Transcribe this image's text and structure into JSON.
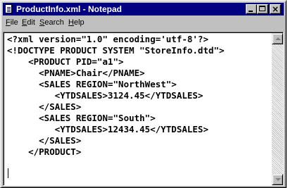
{
  "window": {
    "title": "ProductInfo.xml - Notepad",
    "icon": "notepad-icon"
  },
  "controls": {
    "minimize": "minimize-icon",
    "maximize": "maximize-icon",
    "close": "close-icon",
    "close_glyph": "×"
  },
  "menu": [
    {
      "accel": "F",
      "rest": "ile"
    },
    {
      "accel": "E",
      "rest": "dit"
    },
    {
      "accel": "S",
      "rest": "earch"
    },
    {
      "accel": "H",
      "rest": "elp"
    }
  ],
  "editor": {
    "lines": [
      "<?xml version=\"1.0\" encoding='utf-8'?>",
      "<!DOCTYPE PRODUCT SYSTEM \"StoreInfo.dtd\">",
      "    <PRODUCT PID=\"a1\">",
      "      <PNAME>Chair</PNAME>",
      "      <SALES REGION=\"NorthWest\">",
      "         <YTDSALES>3124.45</YTDSALES>",
      "      </SALES>",
      "      <SALES REGION=\"South\">",
      "         <YTDSALES>12434.45</YTDSALES>",
      "      </SALES>",
      "    </PRODUCT>",
      ""
    ]
  },
  "scrollbar": {
    "up": "arrow-up-icon",
    "down": "arrow-down-icon"
  }
}
